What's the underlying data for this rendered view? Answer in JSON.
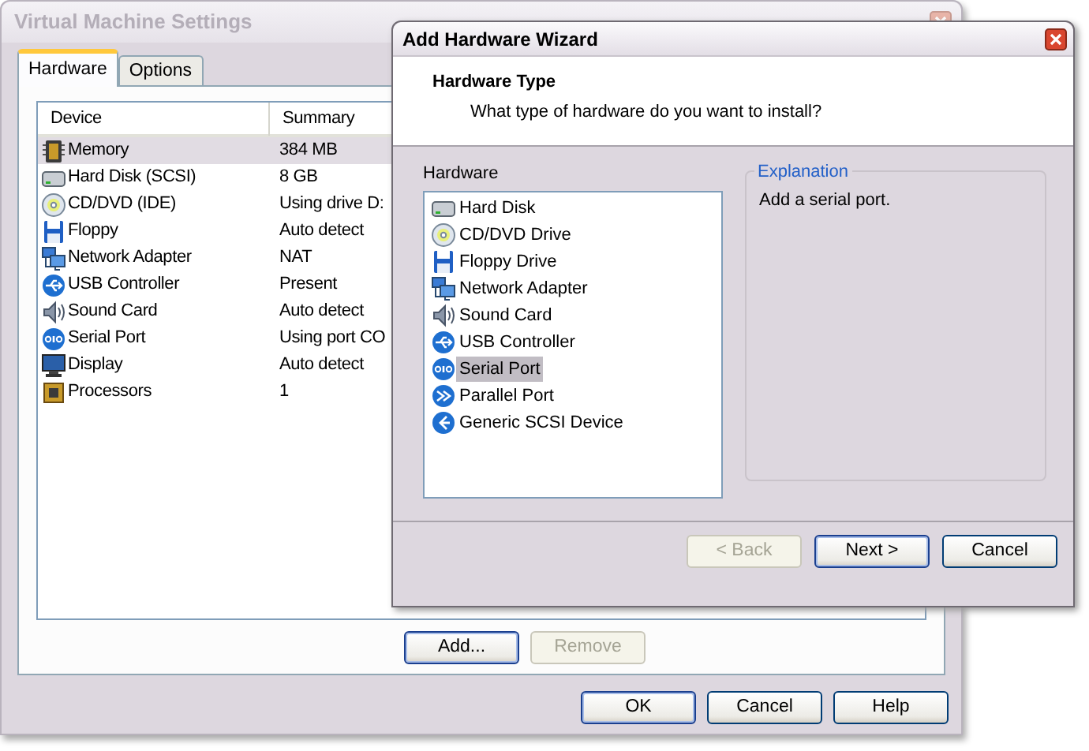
{
  "main_window": {
    "title": "Virtual Machine Settings",
    "active": false,
    "tabs": [
      {
        "label": "Hardware",
        "selected": true
      },
      {
        "label": "Options",
        "selected": false
      }
    ],
    "device_list": {
      "columns": [
        "Device",
        "Summary"
      ],
      "rows": [
        {
          "kind": "memory",
          "device": "Memory",
          "summary": "384 MB",
          "selected": true
        },
        {
          "kind": "disk",
          "device": "Hard Disk (SCSI)",
          "summary": "8 GB",
          "selected": false
        },
        {
          "kind": "cd",
          "device": "CD/DVD (IDE)",
          "summary": "Using drive D:",
          "selected": false
        },
        {
          "kind": "floppy",
          "device": "Floppy",
          "summary": "Auto detect",
          "selected": false
        },
        {
          "kind": "network",
          "device": "Network Adapter",
          "summary": "NAT",
          "selected": false
        },
        {
          "kind": "usb",
          "device": "USB Controller",
          "summary": "Present",
          "selected": false
        },
        {
          "kind": "sound",
          "device": "Sound Card",
          "summary": "Auto detect",
          "selected": false
        },
        {
          "kind": "serial",
          "device": "Serial Port",
          "summary": "Using port CO",
          "selected": false
        },
        {
          "kind": "display",
          "device": "Display",
          "summary": "Auto detect",
          "selected": false
        },
        {
          "kind": "cpu",
          "device": "Processors",
          "summary": "1",
          "selected": false
        }
      ]
    },
    "list_buttons": [
      {
        "label": "Add...",
        "disabled": false,
        "default": true
      },
      {
        "label": "Remove",
        "disabled": true,
        "default": false
      }
    ],
    "buttons": [
      {
        "label": "OK",
        "disabled": false,
        "default": true
      },
      {
        "label": "Cancel",
        "disabled": false,
        "default": false
      },
      {
        "label": "Help",
        "disabled": false,
        "default": false
      }
    ]
  },
  "wizard": {
    "title": "Add Hardware Wizard",
    "active": true,
    "header_title": "Hardware Type",
    "header_subtitle": "What type of hardware do you want to install?",
    "hardware_label": "Hardware",
    "hardware": [
      {
        "kind": "disk",
        "label": "Hard Disk",
        "selected": false
      },
      {
        "kind": "cd",
        "label": "CD/DVD Drive",
        "selected": false
      },
      {
        "kind": "floppy",
        "label": "Floppy Drive",
        "selected": false
      },
      {
        "kind": "network",
        "label": "Network Adapter",
        "selected": false
      },
      {
        "kind": "sound",
        "label": "Sound Card",
        "selected": false
      },
      {
        "kind": "usb",
        "label": "USB Controller",
        "selected": false
      },
      {
        "kind": "serial",
        "label": "Serial Port",
        "selected": true
      },
      {
        "kind": "parallel",
        "label": "Parallel Port",
        "selected": false
      },
      {
        "kind": "scsi",
        "label": "Generic SCSI Device",
        "selected": false
      }
    ],
    "explanation": {
      "legend": "Explanation",
      "text": "Add a serial port."
    },
    "buttons": [
      {
        "label": "< Back",
        "disabled": true,
        "default": false
      },
      {
        "label": "Next >",
        "disabled": false,
        "default": true
      },
      {
        "label": "Cancel",
        "disabled": false,
        "default": false
      }
    ]
  }
}
